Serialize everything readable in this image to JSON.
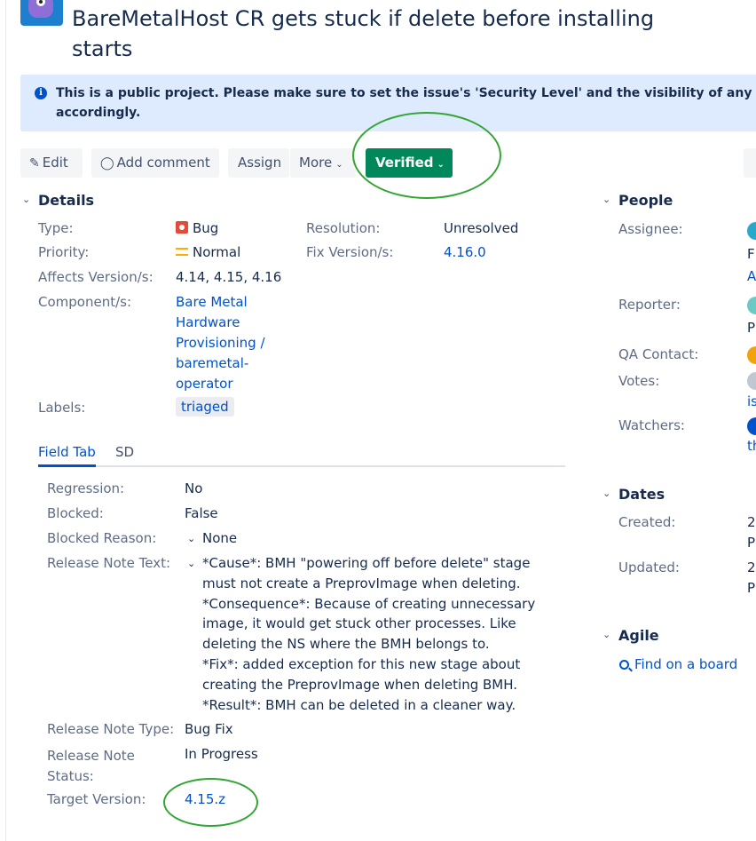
{
  "issue": {
    "title_line1": "BareMetalHost CR gets stuck if delete before installing",
    "title_line2": "starts"
  },
  "banner": {
    "line1": "This is a public project. Please make sure to set the issue's 'Security Level' and the visibility of any comm",
    "line2": "accordingly."
  },
  "toolbar": {
    "edit": "Edit",
    "add_comment": "Add comment",
    "assign": "Assign",
    "more": "More",
    "status": "Verified"
  },
  "details": {
    "heading": "Details",
    "type_label": "Type:",
    "type_value": "Bug",
    "priority_label": "Priority:",
    "priority_value": "Normal",
    "affects_label": "Affects Version/s:",
    "affects_value": "4.14, 4.15, 4.16",
    "component_label": "Component/s:",
    "component_line1": "Bare Metal",
    "component_line2": "Hardware",
    "component_line3": "Provisioning /",
    "component_line4": "baremetal-",
    "component_line5": "operator",
    "labels_label": "Labels:",
    "labels_value": "triaged",
    "resolution_label": "Resolution:",
    "resolution_value": "Unresolved",
    "fix_label": "Fix Version/s:",
    "fix_value": "4.16.0"
  },
  "tabs": {
    "field_tab": "Field Tab",
    "sd": "SD"
  },
  "fields": {
    "regression_label": "Regression:",
    "regression_value": "No",
    "blocked_label": "Blocked:",
    "blocked_value": "False",
    "blocked_reason_label": "Blocked Reason:",
    "blocked_reason_value": "None",
    "release_note_text_label": "Release Note Text:",
    "note_l1": "*Cause*: BMH \"powering off before delete\" stage",
    "note_l2": "must not create a PreprovImage when deleting.",
    "note_l3": "*Consequence*: Because of creating unnecessary",
    "note_l4": "image, it would get stuck other processes. Like",
    "note_l5": "deleting the NS where the BMH belongs to.",
    "note_l6": "*Fix*: added exception for this new stage about",
    "note_l7": "creating the PreprovImage when deleting BMH.",
    "note_l8": "*Result*: BMH can be deleted in a cleaner way.",
    "release_note_type_label": "Release Note Type:",
    "release_note_type_value": "Bug Fix",
    "release_note_status_label1": "Release Note",
    "release_note_status_label2": "Status:",
    "release_note_status_value": "In Progress",
    "target_version_label": "Target Version:",
    "target_version_value": "4.15.z"
  },
  "people": {
    "heading": "People",
    "assignee_label": "Assignee:",
    "assignee_cut1": "F",
    "assignee_cut2": "A",
    "reporter_label": "Reporter:",
    "reporter_cut": "P",
    "qa_label": "QA Contact:",
    "votes_label": "Votes:",
    "votes_cut": "is",
    "watchers_label": "Watchers:",
    "watchers_cut": "th"
  },
  "dates": {
    "heading": "Dates",
    "created_label": "Created:",
    "created_cut1": "2",
    "created_cut2": "P",
    "updated_label": "Updated:",
    "updated_cut1": "2",
    "updated_cut2": "P"
  },
  "agile": {
    "heading": "Agile",
    "find_board": "Find on a board"
  },
  "colors": {
    "link": "#0052cc",
    "status_green": "#00875a",
    "annotation_green": "#33a532",
    "banner_bg": "#deebff"
  }
}
